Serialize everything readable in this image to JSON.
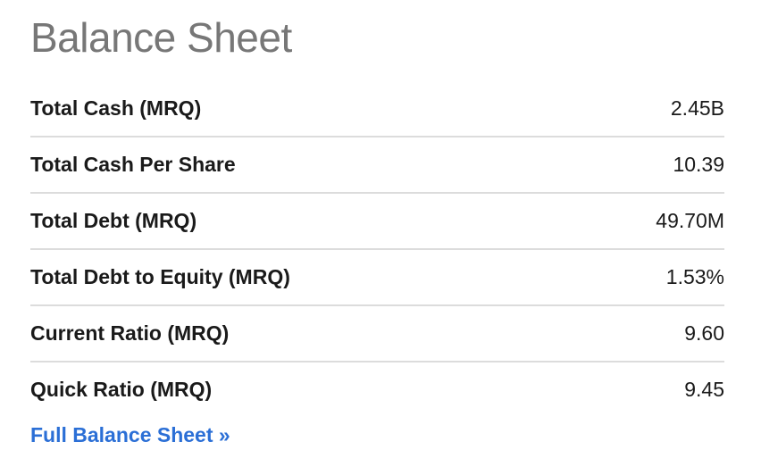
{
  "section": {
    "title": "Balance Sheet"
  },
  "rows": [
    {
      "label": "Total Cash (MRQ)",
      "value": "2.45B"
    },
    {
      "label": "Total Cash Per Share",
      "value": "10.39"
    },
    {
      "label": "Total Debt (MRQ)",
      "value": "49.70M"
    },
    {
      "label": "Total Debt to Equity (MRQ)",
      "value": "1.53%"
    },
    {
      "label": "Current Ratio (MRQ)",
      "value": "9.60"
    },
    {
      "label": "Quick Ratio (MRQ)",
      "value": "9.45"
    }
  ],
  "footer": {
    "link_label": "Full Balance Sheet »"
  },
  "colors": {
    "title": "#777777",
    "text": "#1a1a1a",
    "link": "#2b6fd6",
    "divider": "#dcdcdc"
  }
}
